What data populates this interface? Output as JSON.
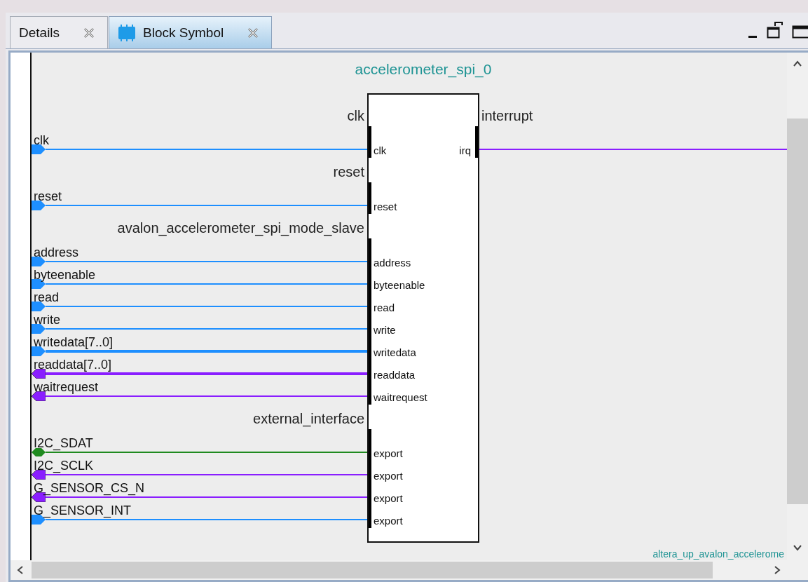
{
  "tabs": [
    {
      "label": "Details",
      "selected": false
    },
    {
      "label": "Block Symbol",
      "selected": true
    }
  ],
  "diagram": {
    "title": "accelerometer_spi_0",
    "interfaces": [
      {
        "name": "clk",
        "kind": "left",
        "ports": [
          {
            "signal": "clk",
            "port": "clk",
            "kind": "in",
            "bus": false
          }
        ]
      },
      {
        "name": "interrupt",
        "kind": "right",
        "ports": [
          {
            "port": "irq",
            "kind": "out",
            "bus": false
          }
        ]
      },
      {
        "name": "reset",
        "kind": "left",
        "ports": [
          {
            "signal": "reset",
            "port": "reset",
            "kind": "in",
            "bus": false
          }
        ]
      },
      {
        "name": "avalon_accelerometer_spi_mode_slave",
        "kind": "left",
        "ports": [
          {
            "signal": "address",
            "port": "address",
            "kind": "in",
            "bus": false
          },
          {
            "signal": "byteenable",
            "port": "byteenable",
            "kind": "in",
            "bus": false
          },
          {
            "signal": "read",
            "port": "read",
            "kind": "in",
            "bus": false
          },
          {
            "signal": "write",
            "port": "write",
            "kind": "in",
            "bus": false
          },
          {
            "signal": "writedata[7..0]",
            "port": "writedata",
            "kind": "in",
            "bus": true
          },
          {
            "signal": "readdata[7..0]",
            "port": "readdata",
            "kind": "out",
            "bus": true
          },
          {
            "signal": "waitrequest",
            "port": "waitrequest",
            "kind": "out",
            "bus": false
          }
        ]
      },
      {
        "name": "external_interface",
        "kind": "left",
        "ports": [
          {
            "signal": "I2C_SDAT",
            "port": "export",
            "kind": "inout",
            "bus": false
          },
          {
            "signal": "I2C_SCLK",
            "port": "export",
            "kind": "out",
            "bus": false
          },
          {
            "signal": "G_SENSOR_CS_N",
            "port": "export",
            "kind": "out",
            "bus": false
          },
          {
            "signal": "G_SENSOR_INT",
            "port": "export",
            "kind": "in",
            "bus": false
          }
        ]
      }
    ],
    "footer": "altera_up_avalon_accelerome"
  }
}
